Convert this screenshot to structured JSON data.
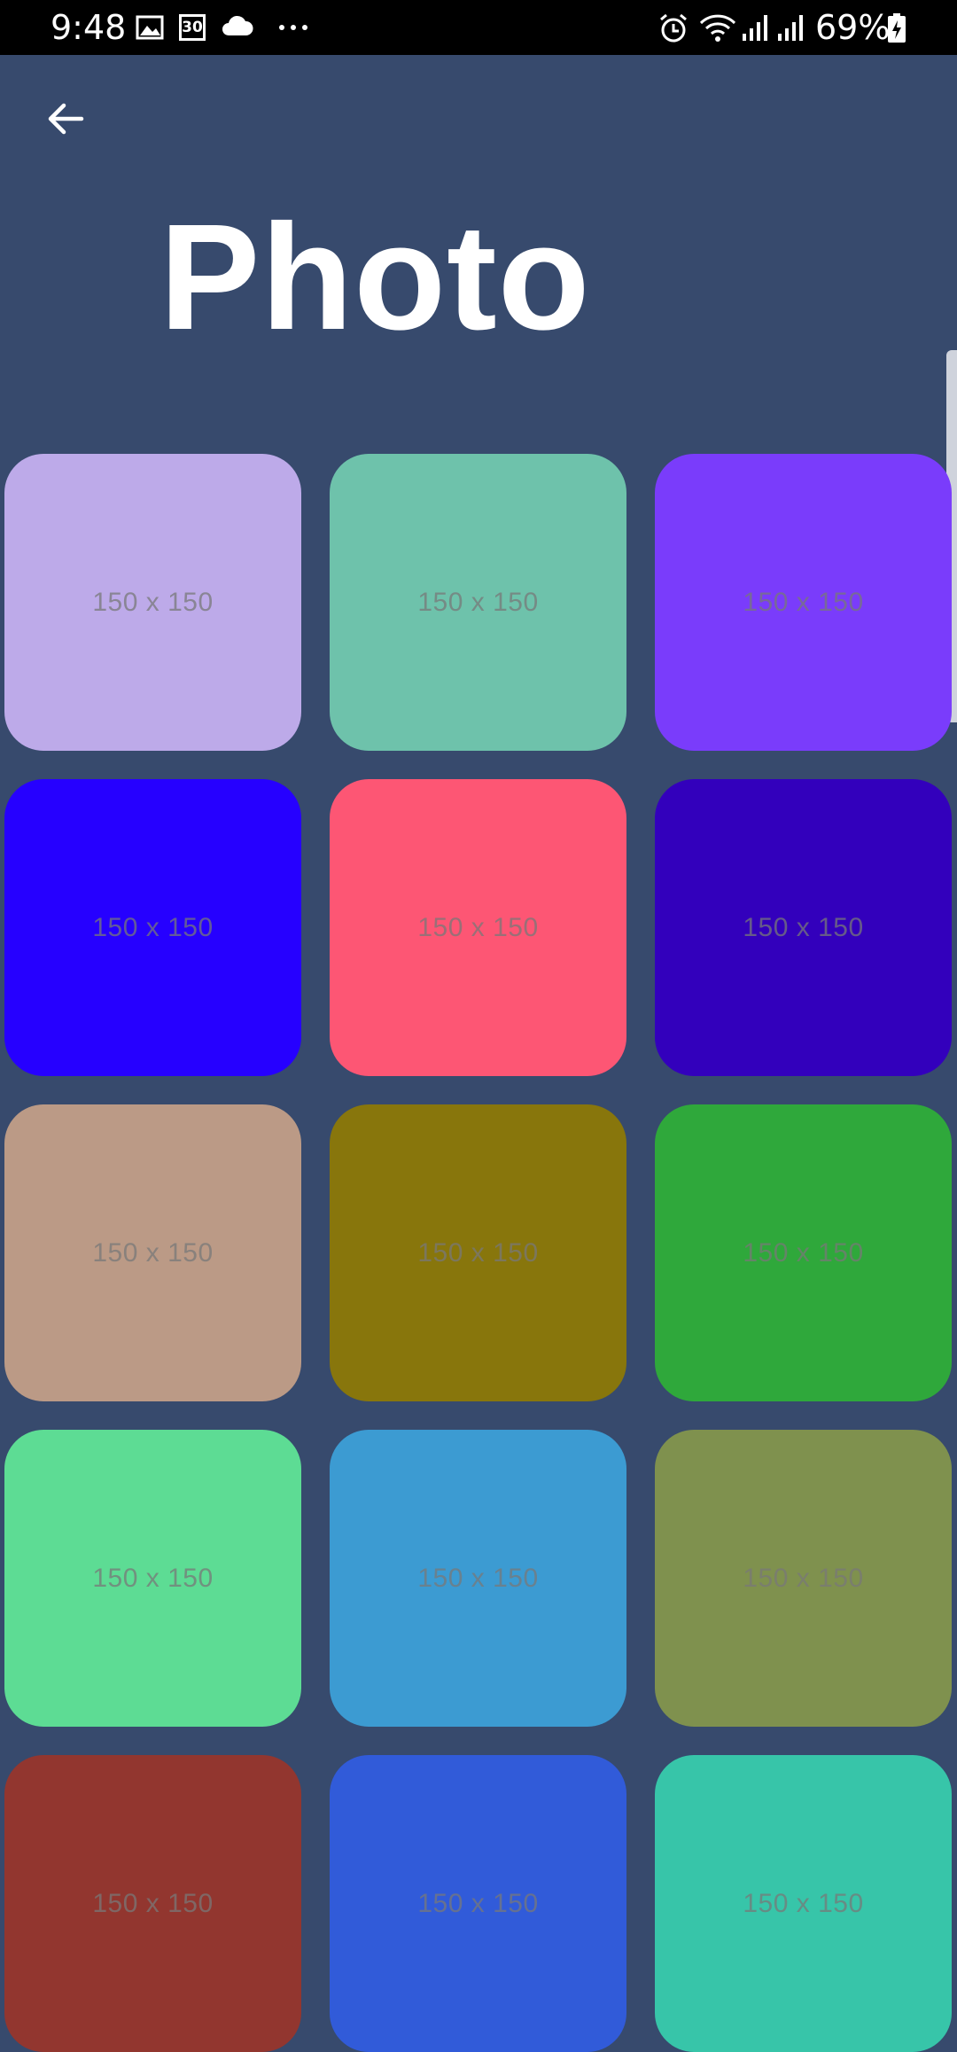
{
  "status_bar": {
    "time": "9:48",
    "badge": "30",
    "battery": "69%"
  },
  "header": {
    "title": "Photo",
    "back_icon": "arrow-left-icon"
  },
  "photos": [
    {
      "label": "150 x 150",
      "color": "#bdaae9"
    },
    {
      "label": "150 x 150",
      "color": "#6ec2ab"
    },
    {
      "label": "150 x 150",
      "color": "#7a3cfb"
    },
    {
      "label": "150 x 150",
      "color": "#2600ff"
    },
    {
      "label": "150 x 150",
      "color": "#fd5674"
    },
    {
      "label": "150 x 150",
      "color": "#3300bc"
    },
    {
      "label": "150 x 150",
      "color": "#bb9a86"
    },
    {
      "label": "150 x 150",
      "color": "#88760c"
    },
    {
      "label": "150 x 150",
      "color": "#2fa83b"
    },
    {
      "label": "150 x 150",
      "color": "#5ddc94"
    },
    {
      "label": "150 x 150",
      "color": "#3c9bd2"
    },
    {
      "label": "150 x 150",
      "color": "#7f914e"
    },
    {
      "label": "150 x 150",
      "color": "#92362f"
    },
    {
      "label": "150 x 150",
      "color": "#315bd9"
    },
    {
      "label": "150 x 150",
      "color": "#37c5a9"
    }
  ]
}
